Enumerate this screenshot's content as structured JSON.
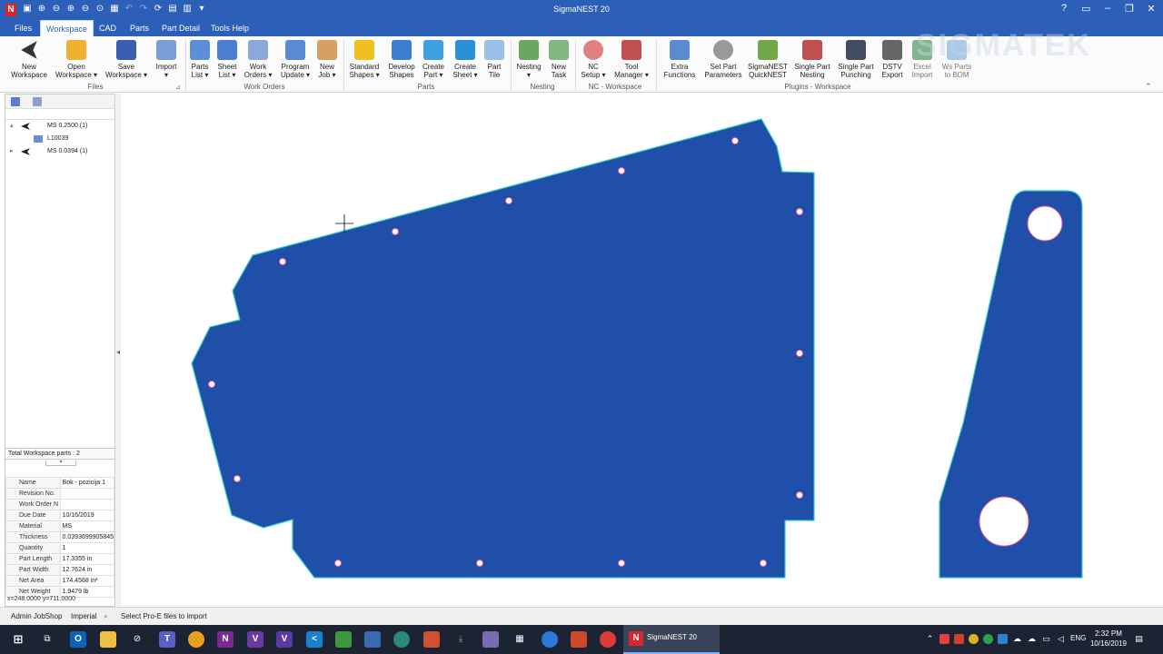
{
  "window": {
    "title": "SigmaNEST 20",
    "app_icon": "N",
    "controls": [
      "?",
      "▭",
      "–",
      "❐",
      "✕"
    ]
  },
  "tabs": [
    "Files",
    "Workspace",
    "CAD",
    "Parts",
    "Part Detail",
    "Tools Help"
  ],
  "active_tab": "Workspace",
  "watermark": "SIGMATEK",
  "ribbon": {
    "groups": {
      "files": "Files",
      "work_orders": "Work Orders",
      "parts": "Parts",
      "nesting": "Nesting",
      "nc_workspace": "NC - Workspace",
      "plugins_workspace": "Plugins - Workspace"
    },
    "buttons": {
      "new_workspace": {
        "line1": "New",
        "line2": "Workspace"
      },
      "open_workspace": {
        "line1": "Open",
        "line2": "Workspace ▾"
      },
      "save_workspace": {
        "line1": "Save",
        "line2": "Workspace ▾"
      },
      "import": {
        "line1": "Import",
        "line2": "▾"
      },
      "parts_list": {
        "line1": "Parts",
        "line2": "List ▾"
      },
      "sheet_list": {
        "line1": "Sheet",
        "line2": "List ▾"
      },
      "work_orders": {
        "line1": "Work",
        "line2": "Orders ▾"
      },
      "program_update": {
        "line1": "Program",
        "line2": "Update ▾"
      },
      "new_job": {
        "line1": "New",
        "line2": "Job ▾"
      },
      "standard_shapes": {
        "line1": "Standard",
        "line2": "Shapes ▾"
      },
      "develop_shapes": {
        "line1": "Develop",
        "line2": "Shapes"
      },
      "create_part": {
        "line1": "Create",
        "line2": "Part ▾"
      },
      "create_sheet": {
        "line1": "Create",
        "line2": "Sheet ▾"
      },
      "part_tile": {
        "line1": "Part",
        "line2": "Tile"
      },
      "nesting": {
        "line1": "Nesting",
        "line2": "▾"
      },
      "new_task": {
        "line1": "New",
        "line2": "Task"
      },
      "nc_setup": {
        "line1": "NC",
        "line2": "Setup ▾"
      },
      "tool_manager": {
        "line1": "Tool",
        "line2": "Manager ▾"
      },
      "extra_functions": {
        "line1": "Extra",
        "line2": "Functions"
      },
      "set_part_parameters": {
        "line1": "Set Part",
        "line2": "Parameters"
      },
      "sigmanest_quicknest": {
        "line1": "SigmaNEST",
        "line2": "QuickNEST"
      },
      "single_part_nesting": {
        "line1": "Single Part",
        "line2": "Nesting"
      },
      "single_part_punching": {
        "line1": "Single Part",
        "line2": "Punching"
      },
      "dstv_export": {
        "line1": "DSTV",
        "line2": "Export"
      },
      "excel_import": {
        "line1": "Excel",
        "line2": "Import"
      },
      "ws_parts_to_bom": {
        "line1": "Ws Parts",
        "line2": "to BOM"
      }
    }
  },
  "tree": {
    "items": [
      {
        "label": "MS 0.2500 (1)",
        "expand": "▴"
      },
      {
        "label": "L10039",
        "expand": ""
      },
      {
        "label": "MS 0.0394 (1)",
        "expand": "▸"
      }
    ]
  },
  "total_parts": "Total Workspace parts : 2",
  "properties": [
    {
      "key": "Name",
      "value": "Bok - pozicija 1"
    },
    {
      "key": "Revision No.",
      "value": ""
    },
    {
      "key": "Work Order N",
      "value": ""
    },
    {
      "key": "Due Date",
      "value": "10/16/2019"
    },
    {
      "key": "Material",
      "value": "MS"
    },
    {
      "key": "Thickness",
      "value": "0.0393699905845"
    },
    {
      "key": "Quantity",
      "value": "1"
    },
    {
      "key": "Part Length",
      "value": "17.3355 in"
    },
    {
      "key": "Part Width",
      "value": "12.7624 in"
    },
    {
      "key": "Net Area",
      "value": "174.4568 in²"
    },
    {
      "key": "Net Weight",
      "value": "1.9479 lb"
    }
  ],
  "coords": "x=248.0000 y=711.0000",
  "status": {
    "user": "Admin JobShop",
    "units": "Imperial",
    "message": "Select Pro-E files to import"
  },
  "colors": {
    "titlebar": "#2b5fb8",
    "part_fill": "#1f4fa8",
    "part_edge": "#2fd0c8",
    "hole_fill": "#ffffff",
    "hole_edge": "#e05aa0"
  },
  "taskbar": {
    "active_app": "SigmaNEST 20",
    "lang": "ENG",
    "time": "2:32 PM",
    "date": "10/16/2019"
  }
}
